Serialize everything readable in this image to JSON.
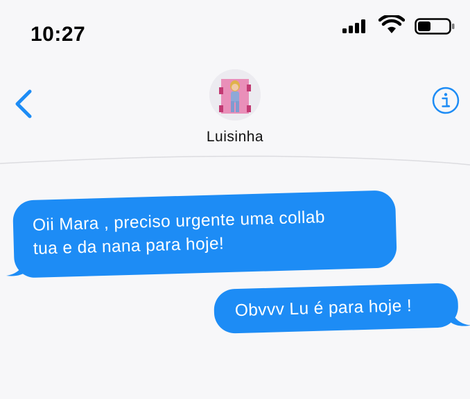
{
  "status": {
    "time": "10:27"
  },
  "header": {
    "contact_name": "Luisinha"
  },
  "messages": [
    {
      "side": "left",
      "lines": [
        "Oii Mara , preciso urgente uma collab",
        "tua e da nana para hoje!"
      ]
    },
    {
      "side": "right",
      "lines": [
        "Obvvv Lu é para hoje !"
      ]
    }
  ],
  "colors": {
    "accent": "#1d8cf5",
    "bubble_text": "#ffffff"
  },
  "icons": {
    "back": "chevron-left-icon",
    "info": "info-circle-icon",
    "signal": "cellular-signal-icon",
    "wifi": "wifi-icon",
    "battery": "battery-icon"
  }
}
